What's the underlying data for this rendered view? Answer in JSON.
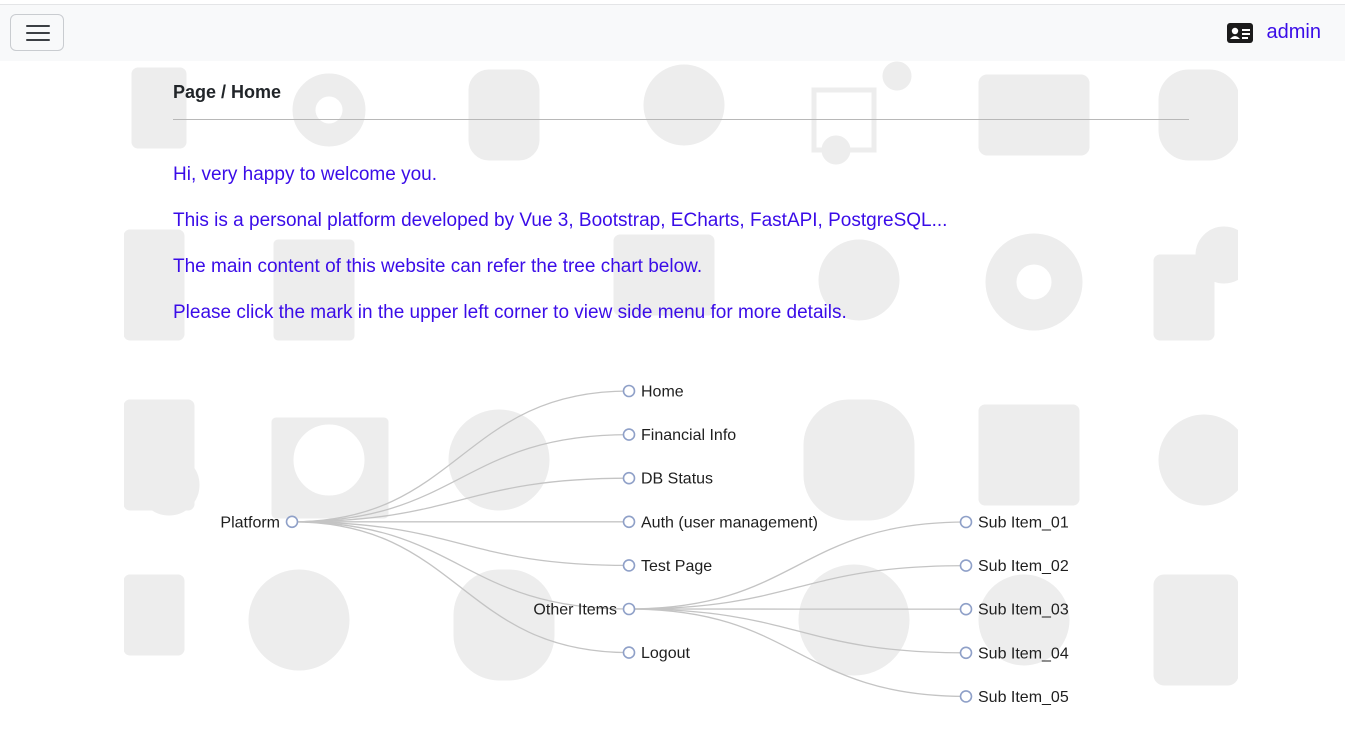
{
  "header": {
    "menu_toggle_icon": "hamburger-icon",
    "user_icon": "id-card-icon",
    "username": "admin",
    "accent_color": "#3a0ce8"
  },
  "breadcrumb": "Page / Home",
  "welcome": {
    "line1": "Hi, very happy to welcome you.",
    "line2": "This is a personal platform developed by Vue 3, Bootstrap, ECharts, FastAPI, PostgreSQL...",
    "line3": "The main content of this website can refer the tree chart below.",
    "line4": "Please click the mark in the upper left corner to view side menu for more details."
  },
  "tree": {
    "root": "Platform",
    "children": [
      {
        "name": "Home"
      },
      {
        "name": "Financial Info"
      },
      {
        "name": "DB Status"
      },
      {
        "name": "Auth (user management)"
      },
      {
        "name": "Test Page"
      },
      {
        "name": "Other Items",
        "children": [
          {
            "name": "Sub Item_01"
          },
          {
            "name": "Sub Item_02"
          },
          {
            "name": "Sub Item_03"
          },
          {
            "name": "Sub Item_04"
          },
          {
            "name": "Sub Item_05"
          }
        ]
      },
      {
        "name": "Logout"
      }
    ],
    "node_color": "#8fa0c8",
    "link_color": "#c4c4c4"
  }
}
